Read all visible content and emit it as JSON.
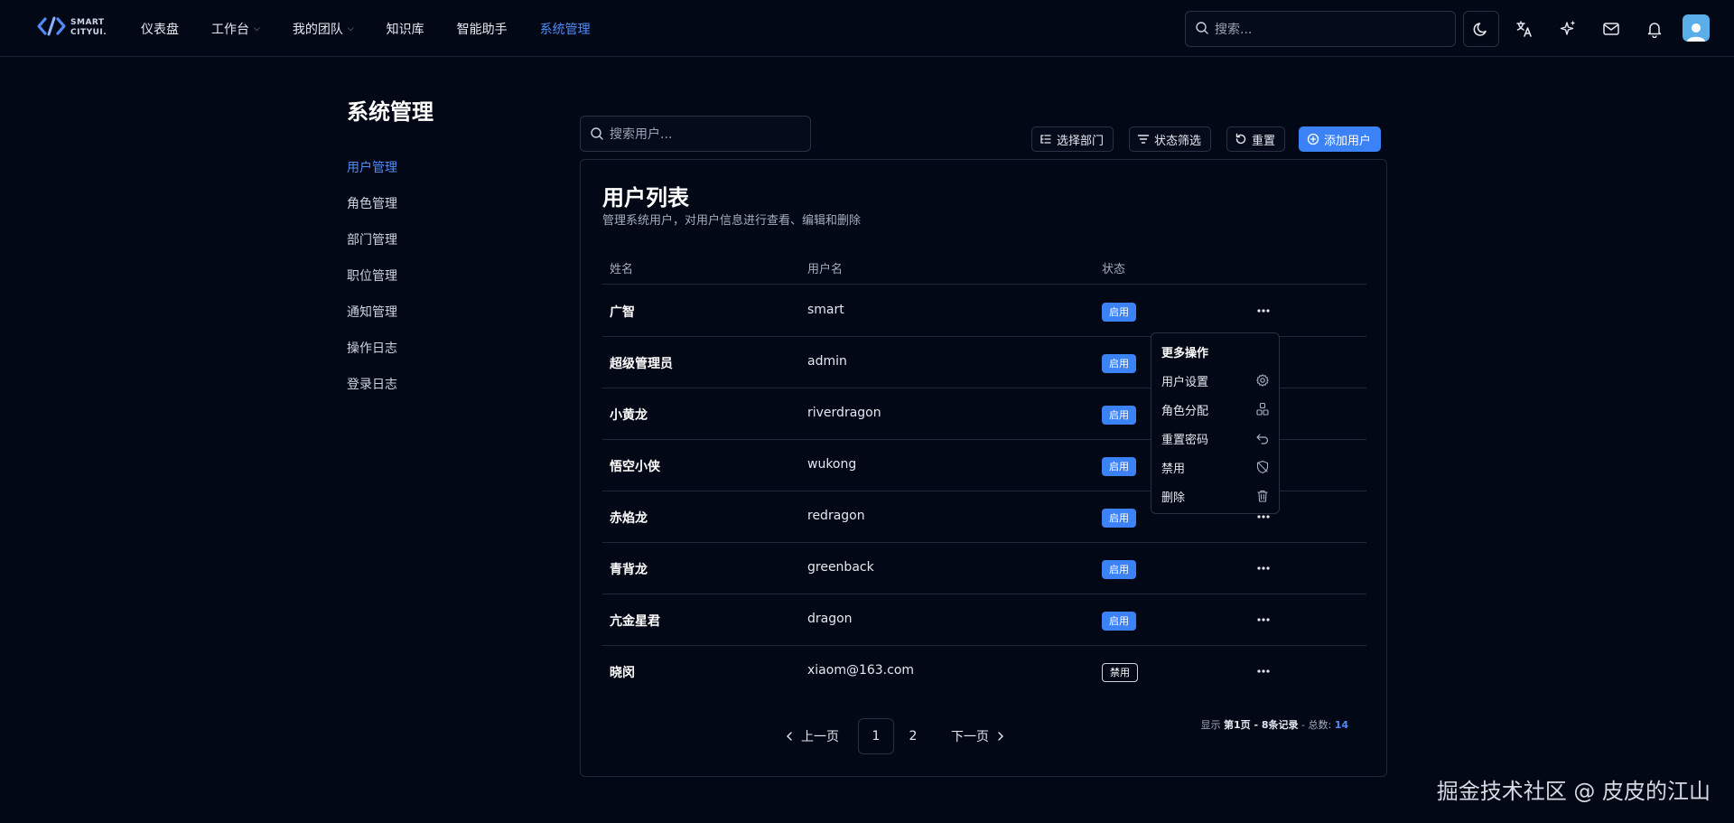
{
  "topbar": {
    "logo_line1": "SMART",
    "logo_line2": "CITYUI.",
    "nav": [
      {
        "label": "仪表盘",
        "dropdown": false,
        "active": false
      },
      {
        "label": "工作台",
        "dropdown": true,
        "active": false
      },
      {
        "label": "我的团队",
        "dropdown": true,
        "active": false
      },
      {
        "label": "知识库",
        "dropdown": false,
        "active": false
      },
      {
        "label": "智能助手",
        "dropdown": false,
        "active": false
      },
      {
        "label": "系统管理",
        "dropdown": false,
        "active": true
      }
    ],
    "search_placeholder": "搜索...",
    "icons": [
      "moon-icon",
      "translate-icon",
      "sparkle-icon",
      "mail-icon",
      "bell-icon"
    ]
  },
  "sidebar": {
    "title": "系统管理",
    "items": [
      {
        "label": "用户管理",
        "active": true
      },
      {
        "label": "角色管理",
        "active": false
      },
      {
        "label": "部门管理",
        "active": false
      },
      {
        "label": "职位管理",
        "active": false
      },
      {
        "label": "通知管理",
        "active": false
      },
      {
        "label": "操作日志",
        "active": false
      },
      {
        "label": "登录日志",
        "active": false
      }
    ]
  },
  "toolbar": {
    "search_placeholder": "搜索用户...",
    "select_dept": "选择部门",
    "status_filter": "状态筛选",
    "reset": "重置",
    "add_user": "添加用户"
  },
  "card": {
    "title": "用户列表",
    "subtitle": "管理系统用户，对用户信息进行查看、编辑和删除",
    "columns": [
      "姓名",
      "用户名",
      "状态"
    ],
    "rows": [
      {
        "name": "广智",
        "username": "smart",
        "status": "启用",
        "enabled": true
      },
      {
        "name": "超级管理员",
        "username": "admin",
        "status": "启用",
        "enabled": true
      },
      {
        "name": "小黄龙",
        "username": "riverdragon",
        "status": "启用",
        "enabled": true
      },
      {
        "name": "悟空小侠",
        "username": "wukong",
        "status": "启用",
        "enabled": true
      },
      {
        "name": "赤焰龙",
        "username": "redragon",
        "status": "启用",
        "enabled": true
      },
      {
        "name": "青背龙",
        "username": "greenback",
        "status": "启用",
        "enabled": true
      },
      {
        "name": "亢金星君",
        "username": "dragon",
        "status": "启用",
        "enabled": true
      },
      {
        "name": "晓闵",
        "username": "xiaom@163.com",
        "status": "禁用",
        "enabled": false
      }
    ]
  },
  "pagination": {
    "prev": "上一页",
    "pages": [
      "1",
      "2"
    ],
    "current": "1",
    "next": "下一页",
    "info_prefix": "显示 ",
    "info_range": "第1页 - 8条记录",
    "info_total_label": " - 总数: ",
    "info_total": "14"
  },
  "menu": {
    "title": "更多操作",
    "items": [
      {
        "label": "用户设置",
        "icon": "gear-icon"
      },
      {
        "label": "角色分配",
        "icon": "cubes-icon"
      },
      {
        "label": "重置密码",
        "icon": "undo-icon"
      },
      {
        "label": "禁用",
        "icon": "shield-off-icon"
      },
      {
        "label": "删除",
        "icon": "trash-icon"
      }
    ]
  },
  "watermark": "掘金技术社区 @ 皮皮的江山"
}
